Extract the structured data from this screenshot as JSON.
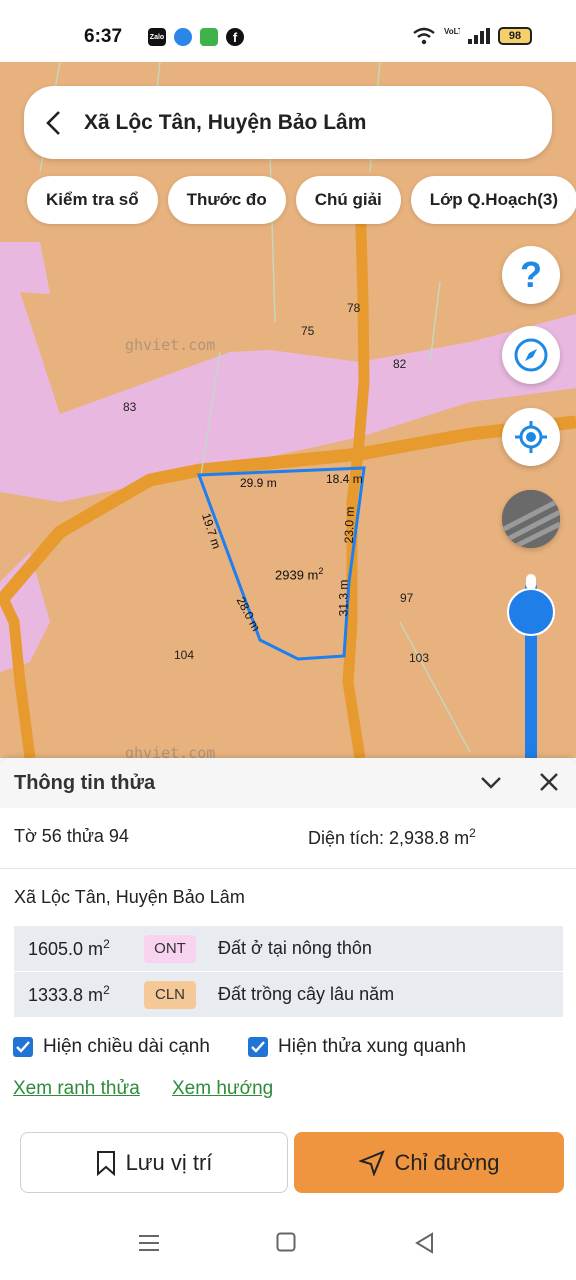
{
  "status": {
    "time": "6:37",
    "battery": "98",
    "network": "VoLTE"
  },
  "header": {
    "title": "Xã Lộc Tân, Huyện Bảo Lâm"
  },
  "toolbar": {
    "chips": [
      "Kiểm tra sổ",
      "Thước đo",
      "Chú giải",
      "Lớp Q.Hoạch(3)"
    ]
  },
  "map": {
    "help_label": "?",
    "watermark": "ghviet.com",
    "parcel_labels": [
      "75",
      "78",
      "82",
      "83",
      "97",
      "104",
      "103"
    ],
    "edges": [
      "29.9 m",
      "18.4 m",
      "19.7 m",
      "23.0 m",
      "28.0 m",
      "31.3 m"
    ],
    "area_label": "2939 m",
    "area_sup": "2",
    "colors": {
      "base": "#e8b27e",
      "residential": "#e9b8e0",
      "road": "#e79a2e",
      "parcel_outline": "#1e7ff0"
    }
  },
  "sheet": {
    "title": "Thông tin thửa",
    "sheet_parcel": "Tờ 56 thửa 94",
    "area_prefix": "Diện tích: 2,938.8 m",
    "area_sup": "2",
    "address": "Xã Lộc Tân, Huyện Bảo Lâm",
    "uses": [
      {
        "area": "1605.0 m",
        "sup": "2",
        "code": "ONT",
        "name": "Đất ở tại nông thôn",
        "color": "#f7d3f0"
      },
      {
        "area": "1333.8 m",
        "sup": "2",
        "code": "CLN",
        "name": "Đất trồng cây lâu năm",
        "color": "#f5c897"
      }
    ],
    "checks": [
      "Hiện chiều dài cạnh",
      "Hiện thửa xung quanh"
    ],
    "links": [
      "Xem ranh thửa",
      "Xem hướng"
    ],
    "save_label": "Lưu vị trí",
    "route_label": "Chỉ đường"
  }
}
